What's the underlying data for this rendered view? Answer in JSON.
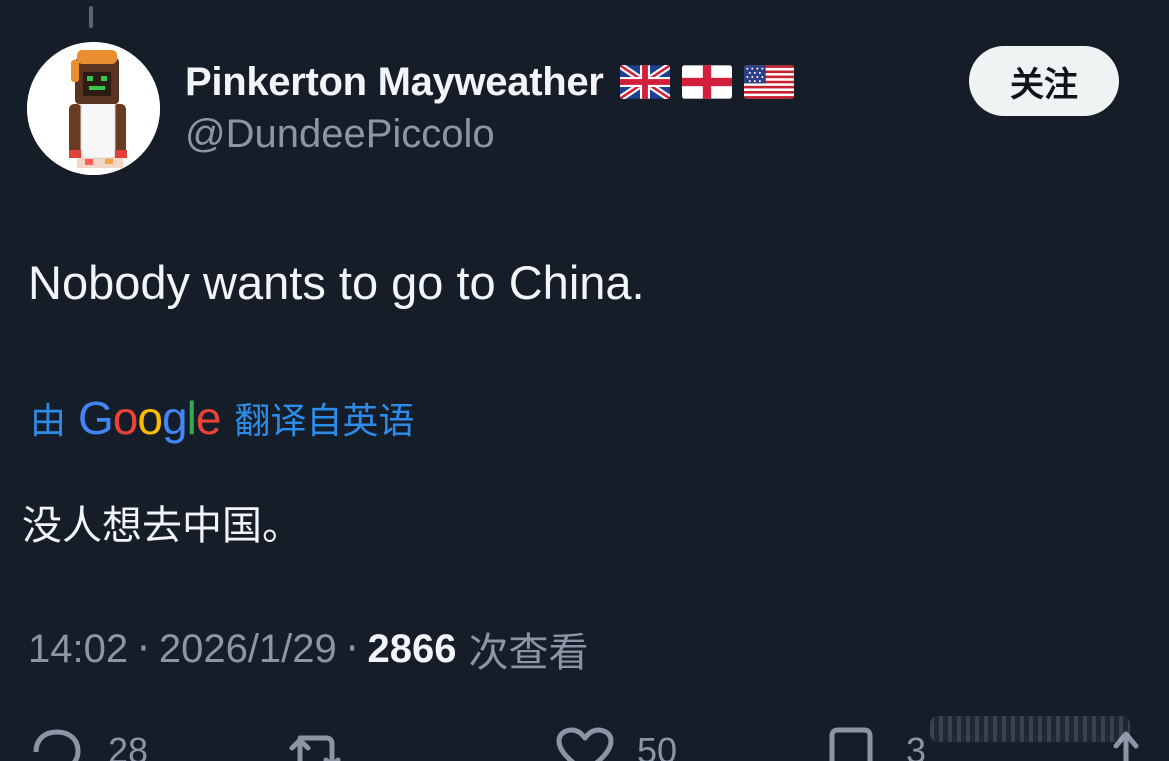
{
  "author": {
    "display_name": "Pinkerton Mayweather",
    "handle": "@DundeePiccolo",
    "flags": [
      "uk-flag-icon",
      "england-flag-icon",
      "us-flag-icon"
    ]
  },
  "follow_button": {
    "label": "关注"
  },
  "tweet": {
    "text": "Nobody wants to go to China.",
    "translation": {
      "prefix": "由",
      "provider_logo": "Google",
      "suffix": "翻译自英语",
      "text": "没人想去中国。"
    }
  },
  "meta": {
    "time": "14:02",
    "separator": "·",
    "date": "2026/1/29",
    "views_count": "2866",
    "views_label": "次查看"
  },
  "actions": {
    "reply_count": "28",
    "like_count": "50",
    "bookmark_count": "3"
  },
  "colors": {
    "background": "#151d29",
    "link_blue": "#2d8ce8",
    "muted_text": "#8b96a5",
    "primary_text": "#f2f4f7"
  }
}
